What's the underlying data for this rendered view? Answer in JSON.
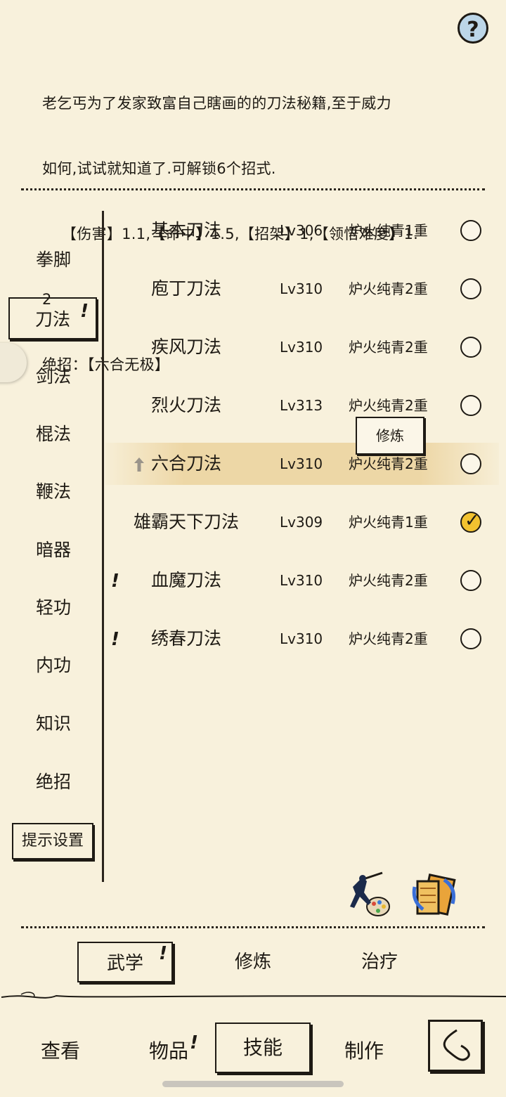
{
  "description": {
    "lines": [
      "老乞丐为了发家致富自己瞎画的的刀法秘籍,至于威力",
      "如何,试试就知道了.可解锁6个招式.",
      "    【伤害】1.1,【命中】1.5,【招架】1,【领悟难度】1.",
      "2",
      "绝招：【六合无极】"
    ]
  },
  "help_label": "?",
  "categories": [
    {
      "label": "拳脚",
      "active": false
    },
    {
      "label": "刀法",
      "active": true,
      "alert": "!"
    },
    {
      "label": "剑法",
      "active": false
    },
    {
      "label": "棍法",
      "active": false
    },
    {
      "label": "鞭法",
      "active": false
    },
    {
      "label": "暗器",
      "active": false
    },
    {
      "label": "轻功",
      "active": false
    },
    {
      "label": "内功",
      "active": false
    },
    {
      "label": "知识",
      "active": false
    },
    {
      "label": "绝招",
      "active": false
    }
  ],
  "tip_settings_label": "提示设置",
  "skills": [
    {
      "name": "基本刀法",
      "level": "Lv306",
      "tier": "炉火纯青1重",
      "checked": false
    },
    {
      "name": "庖丁刀法",
      "level": "Lv310",
      "tier": "炉火纯青2重",
      "checked": false
    },
    {
      "name": "疾风刀法",
      "level": "Lv310",
      "tier": "炉火纯青2重",
      "checked": false
    },
    {
      "name": "烈火刀法",
      "level": "Lv313",
      "tier": "炉火纯青2重",
      "checked": false
    },
    {
      "name": "六合刀法",
      "level": "Lv310",
      "tier": "炉火纯青2重",
      "checked": false,
      "selected": true
    },
    {
      "name": "雄霸天下刀法",
      "level": "Lv309",
      "tier": "炉火纯青1重",
      "checked": true
    },
    {
      "name": "血魔刀法",
      "level": "Lv310",
      "tier": "炉火纯青2重",
      "checked": false,
      "alert": "!"
    },
    {
      "name": "绣春刀法",
      "level": "Lv310",
      "tier": "炉火纯青2重",
      "checked": false,
      "alert": "!"
    }
  ],
  "train_popup_label": "修炼",
  "sub_tabs": [
    {
      "label": "武学",
      "active": true,
      "alert": "!"
    },
    {
      "label": "修炼",
      "active": false
    },
    {
      "label": "治疗",
      "active": false
    }
  ],
  "nav": [
    {
      "label": "查看",
      "active": false
    },
    {
      "label": "物品",
      "active": false,
      "alert": "!"
    },
    {
      "label": "技能",
      "active": true
    },
    {
      "label": "制作",
      "active": false
    }
  ],
  "colors": {
    "background": "#f8f1dc",
    "ink": "#1e1a14",
    "highlight": "#ecd4a0",
    "check": "#f2c230",
    "help": "#bcd6e8"
  }
}
